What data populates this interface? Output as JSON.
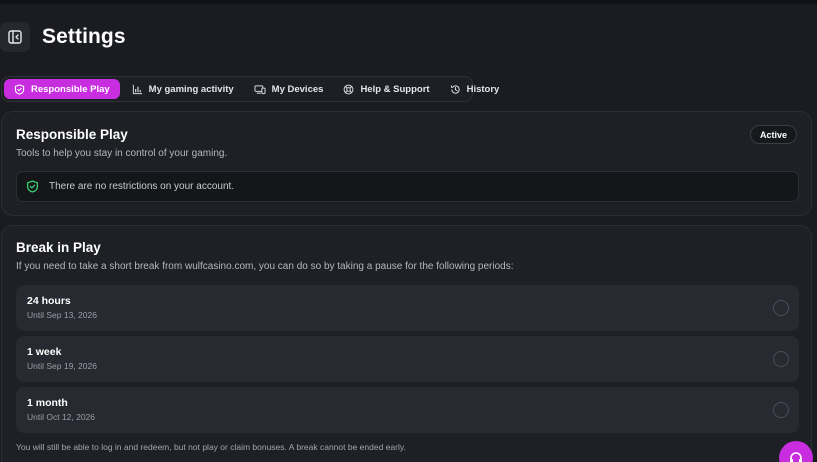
{
  "header": {
    "title": "Settings",
    "toggle_icon": "sidebar-collapse-icon"
  },
  "tabs": [
    {
      "label": "Responsible Play",
      "icon": "shield-icon",
      "active": true
    },
    {
      "label": "My gaming activity",
      "icon": "bar-chart-icon",
      "active": false
    },
    {
      "label": "My Devices",
      "icon": "devices-icon",
      "active": false
    },
    {
      "label": "Help & Support",
      "icon": "lifebuoy-icon",
      "active": false
    },
    {
      "label": "History",
      "icon": "history-icon",
      "active": false
    }
  ],
  "responsible_play": {
    "title": "Responsible Play",
    "subtitle": "Tools to help you stay in control of your gaming.",
    "status": "Active",
    "notice": "There are no restrictions on your account."
  },
  "break_in_play": {
    "title": "Break in Play",
    "subtitle": "If you need to take a short break from wulfcasino.com, you can do so by taking a pause for the following periods:",
    "options": [
      {
        "label": "24 hours",
        "until": "Until Sep 13, 2026"
      },
      {
        "label": "1 week",
        "until": "Until Sep 19, 2026"
      },
      {
        "label": "1 month",
        "until": "Until Oct 12, 2026"
      }
    ],
    "footnote": "You will still be able to log in and redeem, but not play or claim bonuses. A break cannot be ended early."
  },
  "colors": {
    "accent": "#c92de0",
    "background": "#1a1c21",
    "card": "#1e2025",
    "success": "#3ecf6e"
  }
}
